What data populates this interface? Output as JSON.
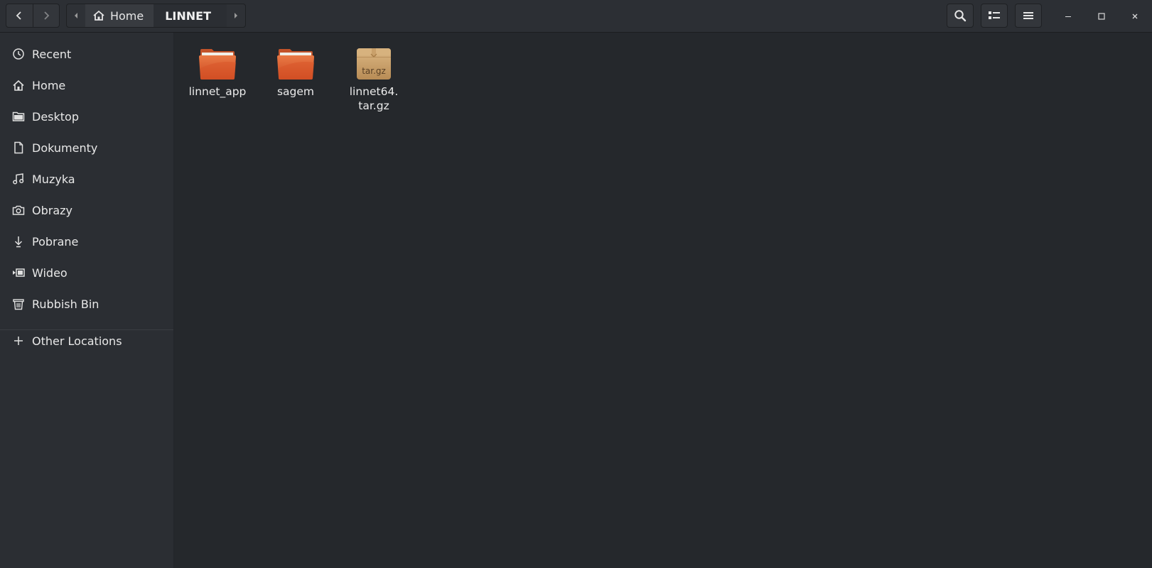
{
  "header": {
    "back_icon": "chevron-left-icon",
    "forward_icon": "chevron-right-icon",
    "breadcrumb": {
      "home_label": "Home",
      "current_label": "LINNET"
    },
    "search_icon": "search-icon",
    "view_icon": "list-view-icon",
    "menu_icon": "hamburger-menu-icon",
    "window_controls": [
      "minimize-icon",
      "maximize-icon",
      "close-icon"
    ]
  },
  "sidebar": {
    "items": [
      {
        "label": "Recent",
        "icon": "clock-icon"
      },
      {
        "label": "Home",
        "icon": "home-icon"
      },
      {
        "label": "Desktop",
        "icon": "folder-icon"
      },
      {
        "label": "Dokumenty",
        "icon": "document-icon"
      },
      {
        "label": "Muzyka",
        "icon": "music-icon"
      },
      {
        "label": "Obrazy",
        "icon": "camera-icon"
      },
      {
        "label": "Pobrane",
        "icon": "download-icon"
      },
      {
        "label": "Wideo",
        "icon": "video-icon"
      },
      {
        "label": "Rubbish Bin",
        "icon": "trash-icon"
      }
    ],
    "other_locations": {
      "label": "Other Locations",
      "icon": "plus-icon"
    }
  },
  "files": [
    {
      "name": "linnet_app",
      "type": "folder"
    },
    {
      "name": "sagem",
      "type": "folder"
    },
    {
      "name_line1": "linnet64.",
      "name_line2": "tar.gz",
      "type": "archive",
      "badge": "tar.gz"
    }
  ],
  "colors": {
    "folder": "#e0622f",
    "folder_top": "#f0efe9",
    "archive": "#c9a06a",
    "background": "#25282c",
    "sidebar": "#2b2e33"
  }
}
